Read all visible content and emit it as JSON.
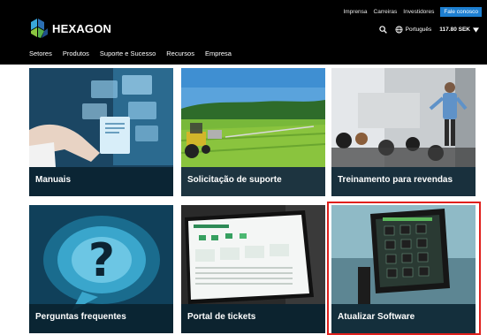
{
  "header": {
    "brand": "HEXAGON",
    "utility_links": [
      "Imprensa",
      "Carreiras",
      "Investidores"
    ],
    "contact_label": "Fale conosco",
    "language": "Português",
    "currency": "117.80 SEK",
    "nav": [
      "Setores",
      "Produtos",
      "Suporte e Sucesso",
      "Recursos",
      "Empresa"
    ]
  },
  "tiles": [
    {
      "label": "Manuais"
    },
    {
      "label": "Solicitação de suporte"
    },
    {
      "label": "Treinamento para revendas"
    },
    {
      "label": "Perguntas frequentes"
    },
    {
      "label": "Portal de tickets"
    },
    {
      "label": "Atualizar Software"
    }
  ],
  "colors": {
    "header_bg": "#000000",
    "contact_bg": "#1d7fd1",
    "caption_bg": "#0a2330",
    "highlight": "#e0201c"
  }
}
